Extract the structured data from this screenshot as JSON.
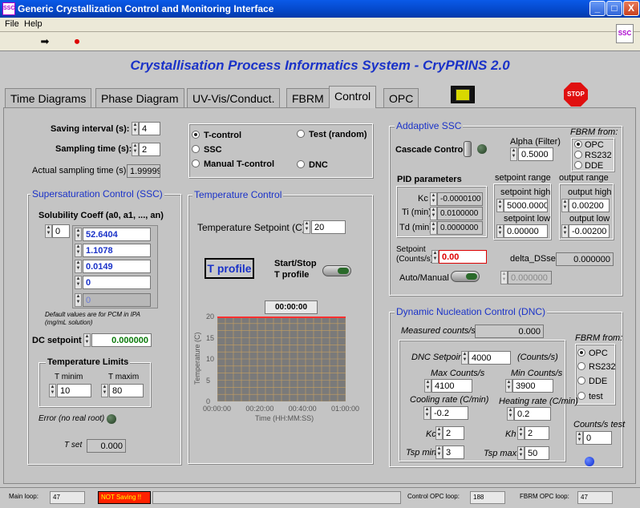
{
  "window": {
    "title": "Generic Crystallization Control and Monitoring Interface",
    "app_icon": "SSC",
    "controls": [
      "_",
      "□",
      "X"
    ]
  },
  "menu": {
    "file": "File",
    "help": "Help"
  },
  "toolbar": {
    "run_icon": "arrow-right-icon",
    "stop_icon": "stop-circle-icon",
    "logo": "SSC"
  },
  "header": {
    "title": "Crystallisation Process Informatics System - CryPRINS 2.0"
  },
  "tabs": [
    "Time Diagrams",
    "Phase Diagram",
    "UV-Vis/Conduct.",
    "FBRM",
    "Control",
    "OPC"
  ],
  "active_tab": "Control",
  "stop_label": "STOP",
  "general": {
    "saving_interval_label": "Saving interval (s):",
    "saving_interval": "4",
    "sampling_time_label": "Sampling time (s):",
    "sampling_time": "2",
    "actual_sampling_label": "Actual sampling time (s)",
    "actual_sampling": "1.99999"
  },
  "mode": {
    "t_control": "T-control",
    "ssc": "SSC",
    "manual": "Manual T-control",
    "test": "Test (random)",
    "dnc": "DNC",
    "selected": "T-control"
  },
  "ssc": {
    "title": "Supersaturation Control (SSC)",
    "solubility_label": "Solubility Coeff (a0, a1, ..., an)",
    "index": "0",
    "coeffs": [
      "52.6404",
      "1.1078",
      "0.0149",
      "0",
      "0"
    ],
    "note": "Default values are for PCM in IPA (mg/mL solution)",
    "dc_label": "DC setpoint",
    "dc_value": "0.000000",
    "tlimits_title": "Temperature Limits",
    "tmin_label": "T minim",
    "tmin": "10",
    "tmax_label": "T maxim",
    "tmax": "80",
    "error_label": "Error (no real root)",
    "tset_label": "T set",
    "tset": "0.000"
  },
  "temp": {
    "title": "Temperature Control",
    "setpoint_label": "Temperature Setpoint (C):",
    "setpoint": "20",
    "tprofile": "T profile",
    "startstop": "Start/Stop",
    "tprofile2": "T profile",
    "time_display": "00:00:00"
  },
  "chart_data": {
    "type": "line",
    "xlabel": "Time (HH:MM:SS)",
    "ylabel": "Temperature (C)",
    "x_ticks": [
      "00:00:00",
      "00:20:00",
      "00:40:00",
      "01:00:00"
    ],
    "y_ticks": [
      "0",
      "5",
      "10",
      "15",
      "20"
    ],
    "ylim": [
      0,
      20
    ],
    "series": [
      {
        "values": [
          20,
          20
        ]
      }
    ],
    "colors": {
      "plot_bg": "#7a7a7a",
      "grid": "#c8a060",
      "line": "#ff3030"
    }
  },
  "assc": {
    "title": "Addaptive SSC",
    "cascade_label": "Cascade Control",
    "alpha_label": "Alpha (Filter)",
    "alpha": "0.5000",
    "fbrm_from": "FBRM from:",
    "fbrm_opts": [
      "OPC",
      "RS232",
      "DDE"
    ],
    "fbrm_selected": "OPC",
    "pid_label": "PID parameters",
    "kc_label": "Kc",
    "kc": "-0.0000100",
    "ti_label": "Ti (min)",
    "ti": "0.0100000",
    "td_label": "Td (min)",
    "td": "0.0000000",
    "sp_range_label": "setpoint range",
    "sp_high_label": "setpoint high",
    "sp_high": "5000.0000",
    "sp_low_label": "setpoint low",
    "sp_low": "0.00000",
    "out_range_label": "output range",
    "out_high_label": "output high",
    "out_high": "0.00200",
    "out_low_label": "output low",
    "out_low": "-0.00200",
    "setpoint_label": "Setpoint\n(Counts/s)",
    "setpoint": "0.00",
    "delta_label": "delta_DSset:",
    "delta": "0.000000",
    "automan_label": "Auto/Manual",
    "manual_val": "0.000000"
  },
  "dnc": {
    "title": "Dynamic Nucleation Control (DNC)",
    "measured_label": "Measured counts/s:",
    "measured": "0.000",
    "fbrm_from": "FBRM from:",
    "fbrm_opts": [
      "OPC",
      "RS232",
      "DDE",
      "test"
    ],
    "fbrm_selected": "OPC",
    "setpoint_label": "DNC Setpoint",
    "setpoint": "4000",
    "counts_unit": "(Counts/s)",
    "max_label": "Max Counts/s",
    "max": "4100",
    "min_label": "Min Counts/s",
    "min": "3900",
    "cool_label": "Cooling rate (C/min)",
    "cool": "-0.2",
    "heat_label": "Heating rate (C/min)",
    "heat": "0.2",
    "kc_label": "Kc",
    "kc": "2",
    "kh_label": "Kh",
    "kh": "2",
    "tspmin_label": "Tsp min:",
    "tspmin": "3",
    "tspmax_label": "Tsp max:",
    "tspmax": "50",
    "test_label": "Counts/s test",
    "test": "0"
  },
  "status": {
    "main_label": "Main loop:",
    "main": "47",
    "not_saving": "NOT Saving !!",
    "control_label": "Control OPC loop:",
    "control": "188",
    "fbrm_label": "FBRM OPC loop:",
    "fbrm": "47"
  }
}
